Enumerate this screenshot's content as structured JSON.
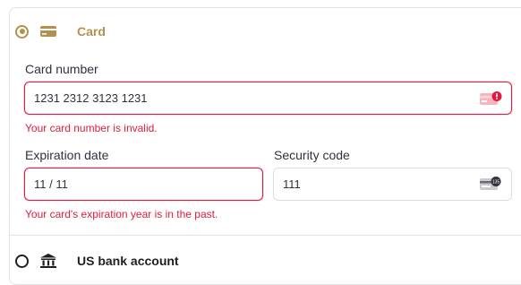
{
  "payment_methods": {
    "card": {
      "label": "Card",
      "selected": true,
      "icon": "credit-card-icon"
    },
    "bank": {
      "label": "US bank account",
      "selected": false,
      "icon": "bank-icon"
    }
  },
  "card_form": {
    "card_number": {
      "label": "Card number",
      "value": "1231 2312 3123 1231",
      "error": "Your card number is invalid.",
      "icon": "card-error-icon"
    },
    "expiration": {
      "label": "Expiration date",
      "value": "11 / 11",
      "error": "Your card's expiration year is in the past."
    },
    "security_code": {
      "label": "Security code",
      "value": "111",
      "icon": "cvc-card-icon",
      "icon_text": "135"
    }
  },
  "colors": {
    "accent": "#b39050",
    "error": "#df1b41",
    "border": "#dcdcdc"
  }
}
